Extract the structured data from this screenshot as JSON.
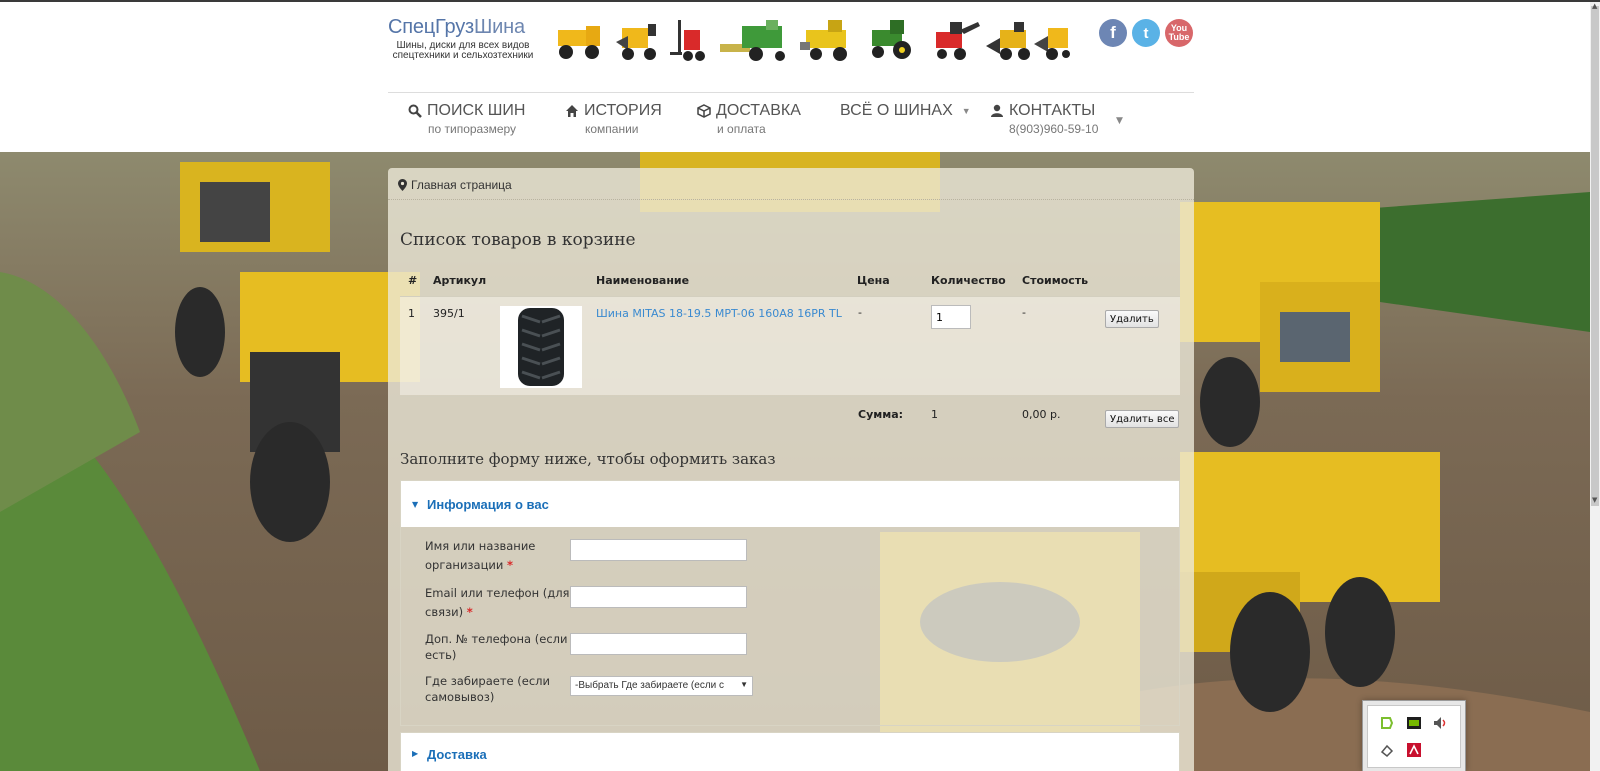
{
  "logo": {
    "title_a": "СпецГруз",
    "title_b": "Шина",
    "subtitle_1": "Шины, диски для всех видов",
    "subtitle_2": "спецтехники и сельхозтехники"
  },
  "social": {
    "facebook": "f",
    "twitter": "t",
    "youtube": "You Tube"
  },
  "nav": [
    {
      "label": "ПОИСК ШИН",
      "sub": "по типоразмеру",
      "icon": "search-icon"
    },
    {
      "label": "ИСТОРИЯ",
      "sub": "компании",
      "icon": "home-icon"
    },
    {
      "label": "ДОСТАВКА",
      "sub": "и оплата",
      "icon": "box-icon"
    },
    {
      "label": "ВСЁ О ШИНАХ",
      "sub": "",
      "icon": "caret-down-icon"
    },
    {
      "label": "КОНТАКТЫ",
      "sub": "8(903)960-59-10",
      "icon": "user-icon"
    }
  ],
  "breadcrumb": "Главная страница",
  "cart": {
    "title": "Список товаров в корзине",
    "columns": [
      "#",
      "Артикул",
      "Наименование",
      "Цена",
      "Количество",
      "Стоимость"
    ],
    "rows": [
      {
        "num": "1",
        "sku": "395/1",
        "name": "Шина MITAS 18-19.5 MPT-06 160A8 16PR TL",
        "price": "-",
        "qty": "1",
        "cost": "-",
        "delete_label": "Удалить"
      }
    ],
    "total_label": "Сумма:",
    "total_qty": "1",
    "total_cost": "0,00 р.",
    "delete_all_label": "Удалить все"
  },
  "form": {
    "title": "Заполните форму ниже, чтобы оформить заказ",
    "section_info": "Информация о вас",
    "fields": [
      {
        "label": "Имя или название организации",
        "required": "*"
      },
      {
        "label": "Email или телефон (для связи)",
        "required": "*"
      },
      {
        "label": "Доп. № телефона (если есть)"
      },
      {
        "label": "Где забираете (если самовывоз)"
      }
    ],
    "pickup_select": "-Выбрать Где забираете (если с",
    "section_delivery": "Доставка"
  },
  "colors": {
    "accent": "#1b6fb8",
    "link": "#3a8ad0",
    "required": "#d92a2a",
    "logo": "#5575a8"
  }
}
